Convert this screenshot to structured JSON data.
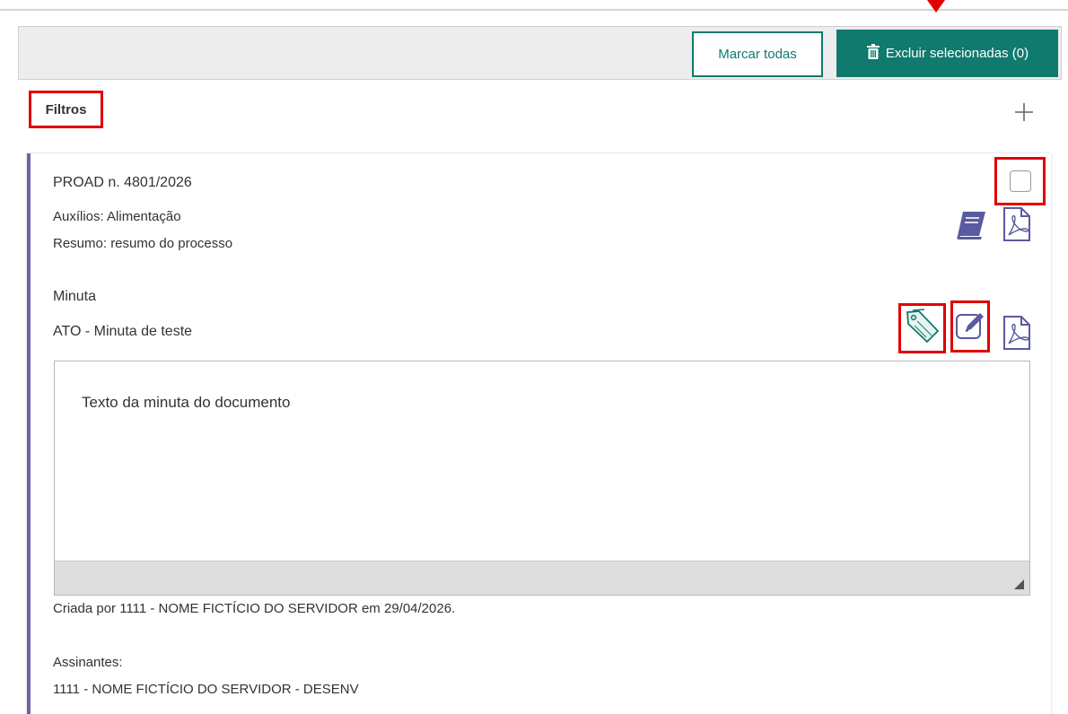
{
  "toolbar": {
    "mark_all_label": "Marcar todas",
    "delete_selected_label": "Excluir selecionadas (0)"
  },
  "filters": {
    "label": "Filtros",
    "add_icon": "plus-icon"
  },
  "card": {
    "process_number": "PROAD n. 4801/2026",
    "auxilios": "Auxílios: Alimentação",
    "resumo": "Resumo: resumo do processo",
    "section_title": "Minuta",
    "document_title": "ATO - Minuta de teste",
    "document_text": "Texto da minuta do documento",
    "created_by": "Criada por 1111 - NOME FICTÍCIO DO SERVIDOR em 29/04/2026.",
    "signers_label": "Assinantes:",
    "signer": "1111 - NOME FICTÍCIO DO SERVIDOR - DESENV"
  },
  "colors": {
    "primary": "#0f7a6d",
    "accent_border": "#6a65aa",
    "highlight": "#e00000",
    "icon_purple": "#5a5aa0"
  },
  "icons": [
    "trash-icon",
    "plus-icon",
    "book-icon",
    "pdf-icon",
    "tags-icon",
    "edit-icon"
  ]
}
